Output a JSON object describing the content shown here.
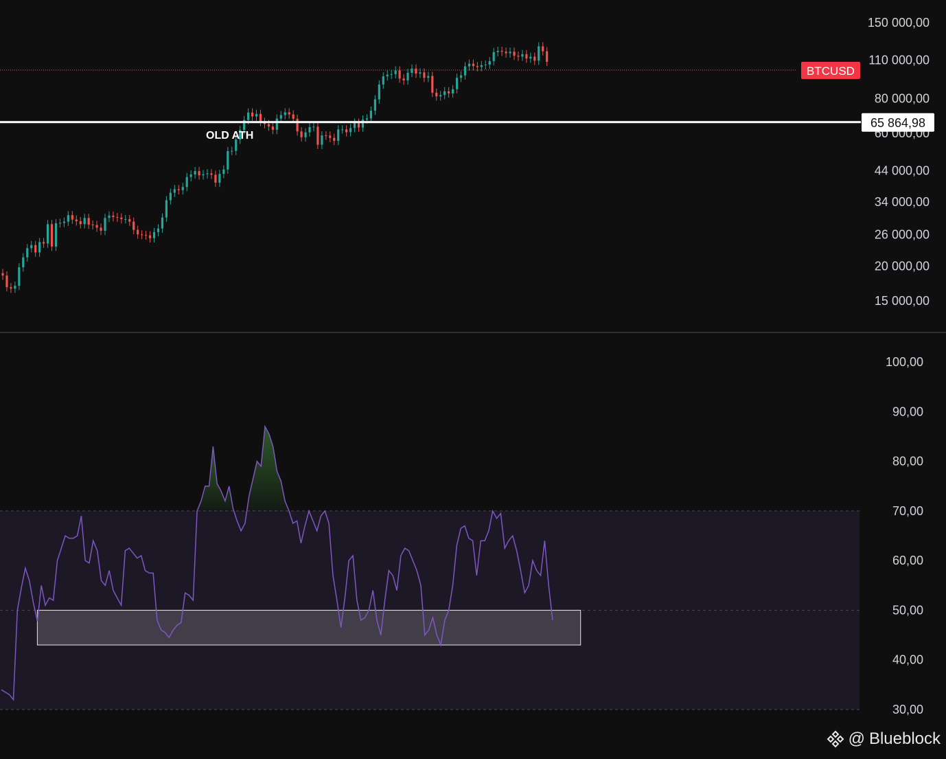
{
  "chart_data": [
    {
      "type": "candlestick",
      "title": "",
      "scale": "log",
      "ylim": [
        13500,
        165000
      ],
      "ticks": [
        "150 000,00",
        "110 000,00",
        "80 000,00",
        "60 000,00",
        "44 000,00",
        "34 000,00",
        "26 000,00",
        "20 000,00",
        "15 000,00"
      ],
      "tick_values": [
        150000,
        110000,
        80000,
        60000,
        44000,
        34000,
        26000,
        20000,
        15000
      ],
      "series_label": "BTCUSD",
      "last_price": 101300,
      "horizontal_line": {
        "value": 65864.98,
        "label": "65 864,98"
      },
      "annotation": "OLD ATH",
      "colors": {
        "up": "#26a69a",
        "down": "#ef5350",
        "label_bg": "#f23645",
        "line": "#ffffff"
      },
      "closes": [
        18500,
        16800,
        16600,
        17000,
        19800,
        21500,
        23200,
        23800,
        22400,
        24400,
        24100,
        28300,
        23500,
        28500,
        28600,
        28900,
        30500,
        29400,
        29000,
        28300,
        29800,
        28200,
        28100,
        27500,
        26800,
        29800,
        30400,
        30000,
        29900,
        29500,
        29500,
        28900,
        27000,
        26000,
        25900,
        25800,
        25200,
        26500,
        27300,
        29900,
        34500,
        36700,
        37800,
        37500,
        38500,
        41800,
        42700,
        43900,
        42400,
        42800,
        43100,
        42600,
        39900,
        42900,
        44500,
        51800,
        51900,
        57000,
        61700,
        67000,
        71300,
        69000,
        70500,
        66000,
        64800,
        63500,
        61800,
        67800,
        69800,
        71400,
        70200,
        67700,
        61000,
        58100,
        60500,
        63200,
        63400,
        54600,
        59000,
        58900,
        57800,
        56400,
        62000,
        62000,
        60600,
        62700,
        65500,
        63000,
        67300,
        67900,
        72400,
        79500,
        89900,
        96200,
        97500,
        98000,
        101000,
        94500,
        93000,
        99000,
        102600,
        98400,
        99400,
        95000,
        96500,
        84000,
        81500,
        82400,
        85000,
        83500,
        86500,
        95000,
        97000,
        104500,
        106800,
        104700,
        103900,
        105500,
        106000,
        109100,
        117600,
        118800,
        118000,
        116400,
        118000,
        114100,
        113300,
        115600,
        111500,
        113200,
        109500,
        123300,
        118400,
        108500
      ],
      "candle_start_x": 4,
      "candle_spacing": 5.96,
      "candle_width": 3.2
    },
    {
      "type": "line",
      "title": "",
      "ylim": [
        28,
        108
      ],
      "ticks": [
        "100,00",
        "90,00",
        "80,00",
        "70,00",
        "60,00",
        "50,00",
        "40,00",
        "30,00"
      ],
      "tick_values": [
        100,
        90,
        80,
        70,
        60,
        50,
        40,
        30
      ],
      "bands": {
        "upper": 70,
        "middle": 50,
        "lower": 30
      },
      "highlight_box": {
        "x_from": 9,
        "x_to": 145,
        "y_from": 43,
        "y_to": 50
      },
      "colors": {
        "line": "#7e57c2",
        "band_fill": "#1c1826",
        "overbought_fill": "#2e5a2a",
        "box_fill": "#46414e",
        "box_stroke": "#e8e8e8",
        "dash": "#4a4a55"
      },
      "values": [
        34,
        33.5,
        33,
        32,
        50,
        54.5,
        58.5,
        56,
        51.5,
        47.8,
        55,
        51,
        52.5,
        52,
        60,
        62.5,
        65,
        64.5,
        64.5,
        65,
        69,
        60,
        59.5,
        64,
        62,
        56,
        55,
        58,
        54,
        52.5,
        51,
        62,
        62.5,
        61.5,
        60.5,
        61,
        58,
        57.5,
        57.5,
        48,
        46,
        45.5,
        44.5,
        46,
        47,
        47.5,
        53.5,
        53,
        52,
        70,
        72,
        75,
        75,
        83,
        75.5,
        74,
        72,
        75,
        70.5,
        68,
        66,
        67.5,
        73,
        76.5,
        80,
        79,
        87,
        85.5,
        83,
        78,
        76,
        72,
        70,
        67.5,
        68,
        63.5,
        67,
        70,
        68,
        66,
        69,
        70,
        67.5,
        57,
        52,
        46.5,
        52.5,
        60,
        61,
        52,
        48,
        48.5,
        50,
        54,
        48,
        45,
        52,
        58,
        57,
        54,
        61,
        62.5,
        62,
        60,
        58,
        55,
        45,
        46,
        48.5,
        45,
        43,
        48,
        50,
        55,
        63,
        66.5,
        67,
        64.5,
        64,
        57,
        64,
        64,
        66,
        70,
        68.5,
        69.5,
        62.5,
        64,
        65,
        62,
        58,
        53.5,
        55,
        60,
        58,
        57,
        64,
        55,
        48
      ]
    }
  ],
  "watermark": {
    "at": "@",
    "name": "Blueblock"
  }
}
